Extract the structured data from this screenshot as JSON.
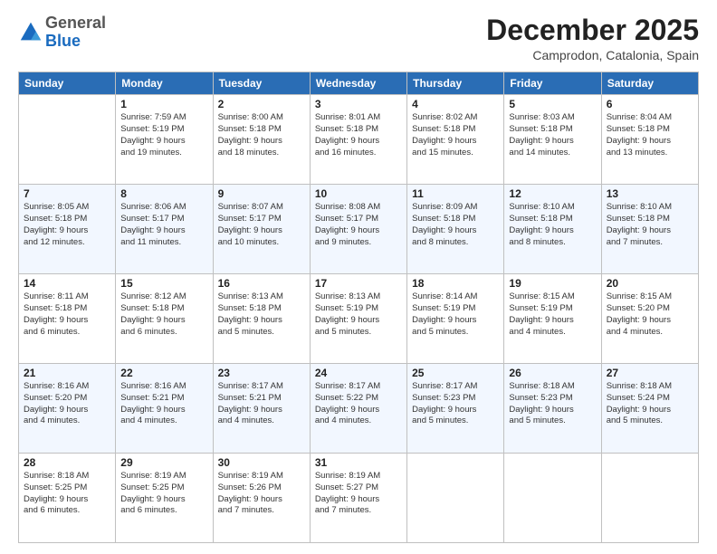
{
  "logo": {
    "general": "General",
    "blue": "Blue"
  },
  "header": {
    "month": "December 2025",
    "location": "Camprodon, Catalonia, Spain"
  },
  "weekdays": [
    "Sunday",
    "Monday",
    "Tuesday",
    "Wednesday",
    "Thursday",
    "Friday",
    "Saturday"
  ],
  "weeks": [
    [
      {
        "day": "",
        "info": ""
      },
      {
        "day": "1",
        "info": "Sunrise: 7:59 AM\nSunset: 5:19 PM\nDaylight: 9 hours\nand 19 minutes."
      },
      {
        "day": "2",
        "info": "Sunrise: 8:00 AM\nSunset: 5:18 PM\nDaylight: 9 hours\nand 18 minutes."
      },
      {
        "day": "3",
        "info": "Sunrise: 8:01 AM\nSunset: 5:18 PM\nDaylight: 9 hours\nand 16 minutes."
      },
      {
        "day": "4",
        "info": "Sunrise: 8:02 AM\nSunset: 5:18 PM\nDaylight: 9 hours\nand 15 minutes."
      },
      {
        "day": "5",
        "info": "Sunrise: 8:03 AM\nSunset: 5:18 PM\nDaylight: 9 hours\nand 14 minutes."
      },
      {
        "day": "6",
        "info": "Sunrise: 8:04 AM\nSunset: 5:18 PM\nDaylight: 9 hours\nand 13 minutes."
      }
    ],
    [
      {
        "day": "7",
        "info": "Sunrise: 8:05 AM\nSunset: 5:18 PM\nDaylight: 9 hours\nand 12 minutes."
      },
      {
        "day": "8",
        "info": "Sunrise: 8:06 AM\nSunset: 5:17 PM\nDaylight: 9 hours\nand 11 minutes."
      },
      {
        "day": "9",
        "info": "Sunrise: 8:07 AM\nSunset: 5:17 PM\nDaylight: 9 hours\nand 10 minutes."
      },
      {
        "day": "10",
        "info": "Sunrise: 8:08 AM\nSunset: 5:17 PM\nDaylight: 9 hours\nand 9 minutes."
      },
      {
        "day": "11",
        "info": "Sunrise: 8:09 AM\nSunset: 5:18 PM\nDaylight: 9 hours\nand 8 minutes."
      },
      {
        "day": "12",
        "info": "Sunrise: 8:10 AM\nSunset: 5:18 PM\nDaylight: 9 hours\nand 8 minutes."
      },
      {
        "day": "13",
        "info": "Sunrise: 8:10 AM\nSunset: 5:18 PM\nDaylight: 9 hours\nand 7 minutes."
      }
    ],
    [
      {
        "day": "14",
        "info": "Sunrise: 8:11 AM\nSunset: 5:18 PM\nDaylight: 9 hours\nand 6 minutes."
      },
      {
        "day": "15",
        "info": "Sunrise: 8:12 AM\nSunset: 5:18 PM\nDaylight: 9 hours\nand 6 minutes."
      },
      {
        "day": "16",
        "info": "Sunrise: 8:13 AM\nSunset: 5:18 PM\nDaylight: 9 hours\nand 5 minutes."
      },
      {
        "day": "17",
        "info": "Sunrise: 8:13 AM\nSunset: 5:19 PM\nDaylight: 9 hours\nand 5 minutes."
      },
      {
        "day": "18",
        "info": "Sunrise: 8:14 AM\nSunset: 5:19 PM\nDaylight: 9 hours\nand 5 minutes."
      },
      {
        "day": "19",
        "info": "Sunrise: 8:15 AM\nSunset: 5:19 PM\nDaylight: 9 hours\nand 4 minutes."
      },
      {
        "day": "20",
        "info": "Sunrise: 8:15 AM\nSunset: 5:20 PM\nDaylight: 9 hours\nand 4 minutes."
      }
    ],
    [
      {
        "day": "21",
        "info": "Sunrise: 8:16 AM\nSunset: 5:20 PM\nDaylight: 9 hours\nand 4 minutes."
      },
      {
        "day": "22",
        "info": "Sunrise: 8:16 AM\nSunset: 5:21 PM\nDaylight: 9 hours\nand 4 minutes."
      },
      {
        "day": "23",
        "info": "Sunrise: 8:17 AM\nSunset: 5:21 PM\nDaylight: 9 hours\nand 4 minutes."
      },
      {
        "day": "24",
        "info": "Sunrise: 8:17 AM\nSunset: 5:22 PM\nDaylight: 9 hours\nand 4 minutes."
      },
      {
        "day": "25",
        "info": "Sunrise: 8:17 AM\nSunset: 5:23 PM\nDaylight: 9 hours\nand 5 minutes."
      },
      {
        "day": "26",
        "info": "Sunrise: 8:18 AM\nSunset: 5:23 PM\nDaylight: 9 hours\nand 5 minutes."
      },
      {
        "day": "27",
        "info": "Sunrise: 8:18 AM\nSunset: 5:24 PM\nDaylight: 9 hours\nand 5 minutes."
      }
    ],
    [
      {
        "day": "28",
        "info": "Sunrise: 8:18 AM\nSunset: 5:25 PM\nDaylight: 9 hours\nand 6 minutes."
      },
      {
        "day": "29",
        "info": "Sunrise: 8:19 AM\nSunset: 5:25 PM\nDaylight: 9 hours\nand 6 minutes."
      },
      {
        "day": "30",
        "info": "Sunrise: 8:19 AM\nSunset: 5:26 PM\nDaylight: 9 hours\nand 7 minutes."
      },
      {
        "day": "31",
        "info": "Sunrise: 8:19 AM\nSunset: 5:27 PM\nDaylight: 9 hours\nand 7 minutes."
      },
      {
        "day": "",
        "info": ""
      },
      {
        "day": "",
        "info": ""
      },
      {
        "day": "",
        "info": ""
      }
    ]
  ]
}
